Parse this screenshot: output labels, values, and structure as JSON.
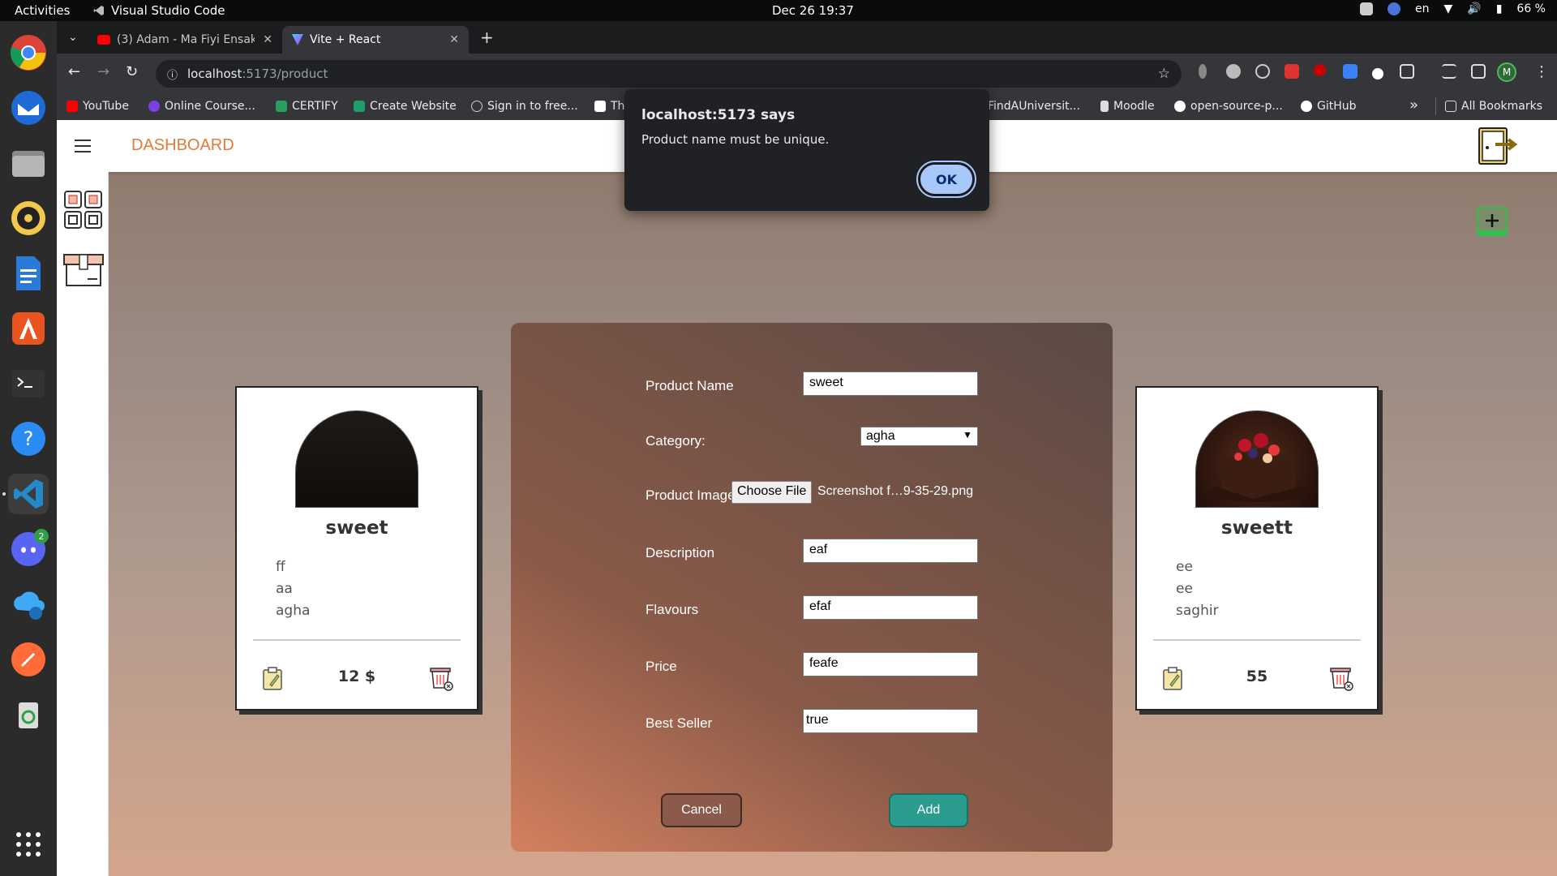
{
  "topbar": {
    "activities": "Activities",
    "app_name": "Visual Studio Code",
    "clock": "Dec 26  19:37",
    "lang": "en",
    "battery": "66 %"
  },
  "dock": {
    "apps": [
      "chrome-icon",
      "thunderbird-icon",
      "files-icon",
      "rhythmbox-icon",
      "writer-icon",
      "app-center-icon",
      "terminal-icon",
      "help-icon",
      "vscode-icon",
      "discord-icon",
      "weather-app-icon",
      "postman-icon",
      "trash-icon"
    ],
    "discord_badge": "2"
  },
  "browser": {
    "tabs": [
      {
        "label": "(3) Adam - Ma Fiyi Ensak",
        "active": false
      },
      {
        "label": "Vite + React",
        "active": true
      }
    ],
    "url_host": "localhost",
    "url_path": ":5173/product",
    "bookmarks": [
      "YouTube",
      "Online Course...",
      "CERTIFY",
      "Create Website",
      "Sign in to free...",
      "Th",
      "FindAUniversit...",
      "Moodle",
      "open-source-p...",
      "GitHub"
    ],
    "all_bookmarks": "All Bookmarks",
    "profile_initial": "M"
  },
  "app": {
    "title": "DASHBOARD"
  },
  "cards": [
    {
      "name": "sweet",
      "lines": [
        "ff",
        "aa",
        "agha"
      ],
      "price": "12 $"
    },
    {
      "name": "sweett",
      "lines": [
        "ee",
        "ee",
        "saghir"
      ],
      "price": "55"
    }
  ],
  "form": {
    "product_name_label": "Product Name",
    "product_name_value": "sweet",
    "category_label": "Category:",
    "category_value": "agha",
    "image_label": "Product Image",
    "choose_file": "Choose File",
    "file_name": "Screenshot f…9-35-29.png",
    "description_label": "Description",
    "description_value": "eaf",
    "flavours_label": "Flavours",
    "flavours_value": "efaf",
    "price_label": "Price",
    "price_value": "feafe",
    "best_seller_label": "Best Seller",
    "best_seller_value": "true",
    "cancel": "Cancel",
    "add": "Add"
  },
  "dialog": {
    "title": "localhost:5173 says",
    "message": "Product name must be unique.",
    "ok": "OK"
  },
  "colors": {
    "accent": "#e07b39",
    "add_button": "#2a9d8f",
    "dialog_ok": "#a8c7fa"
  }
}
